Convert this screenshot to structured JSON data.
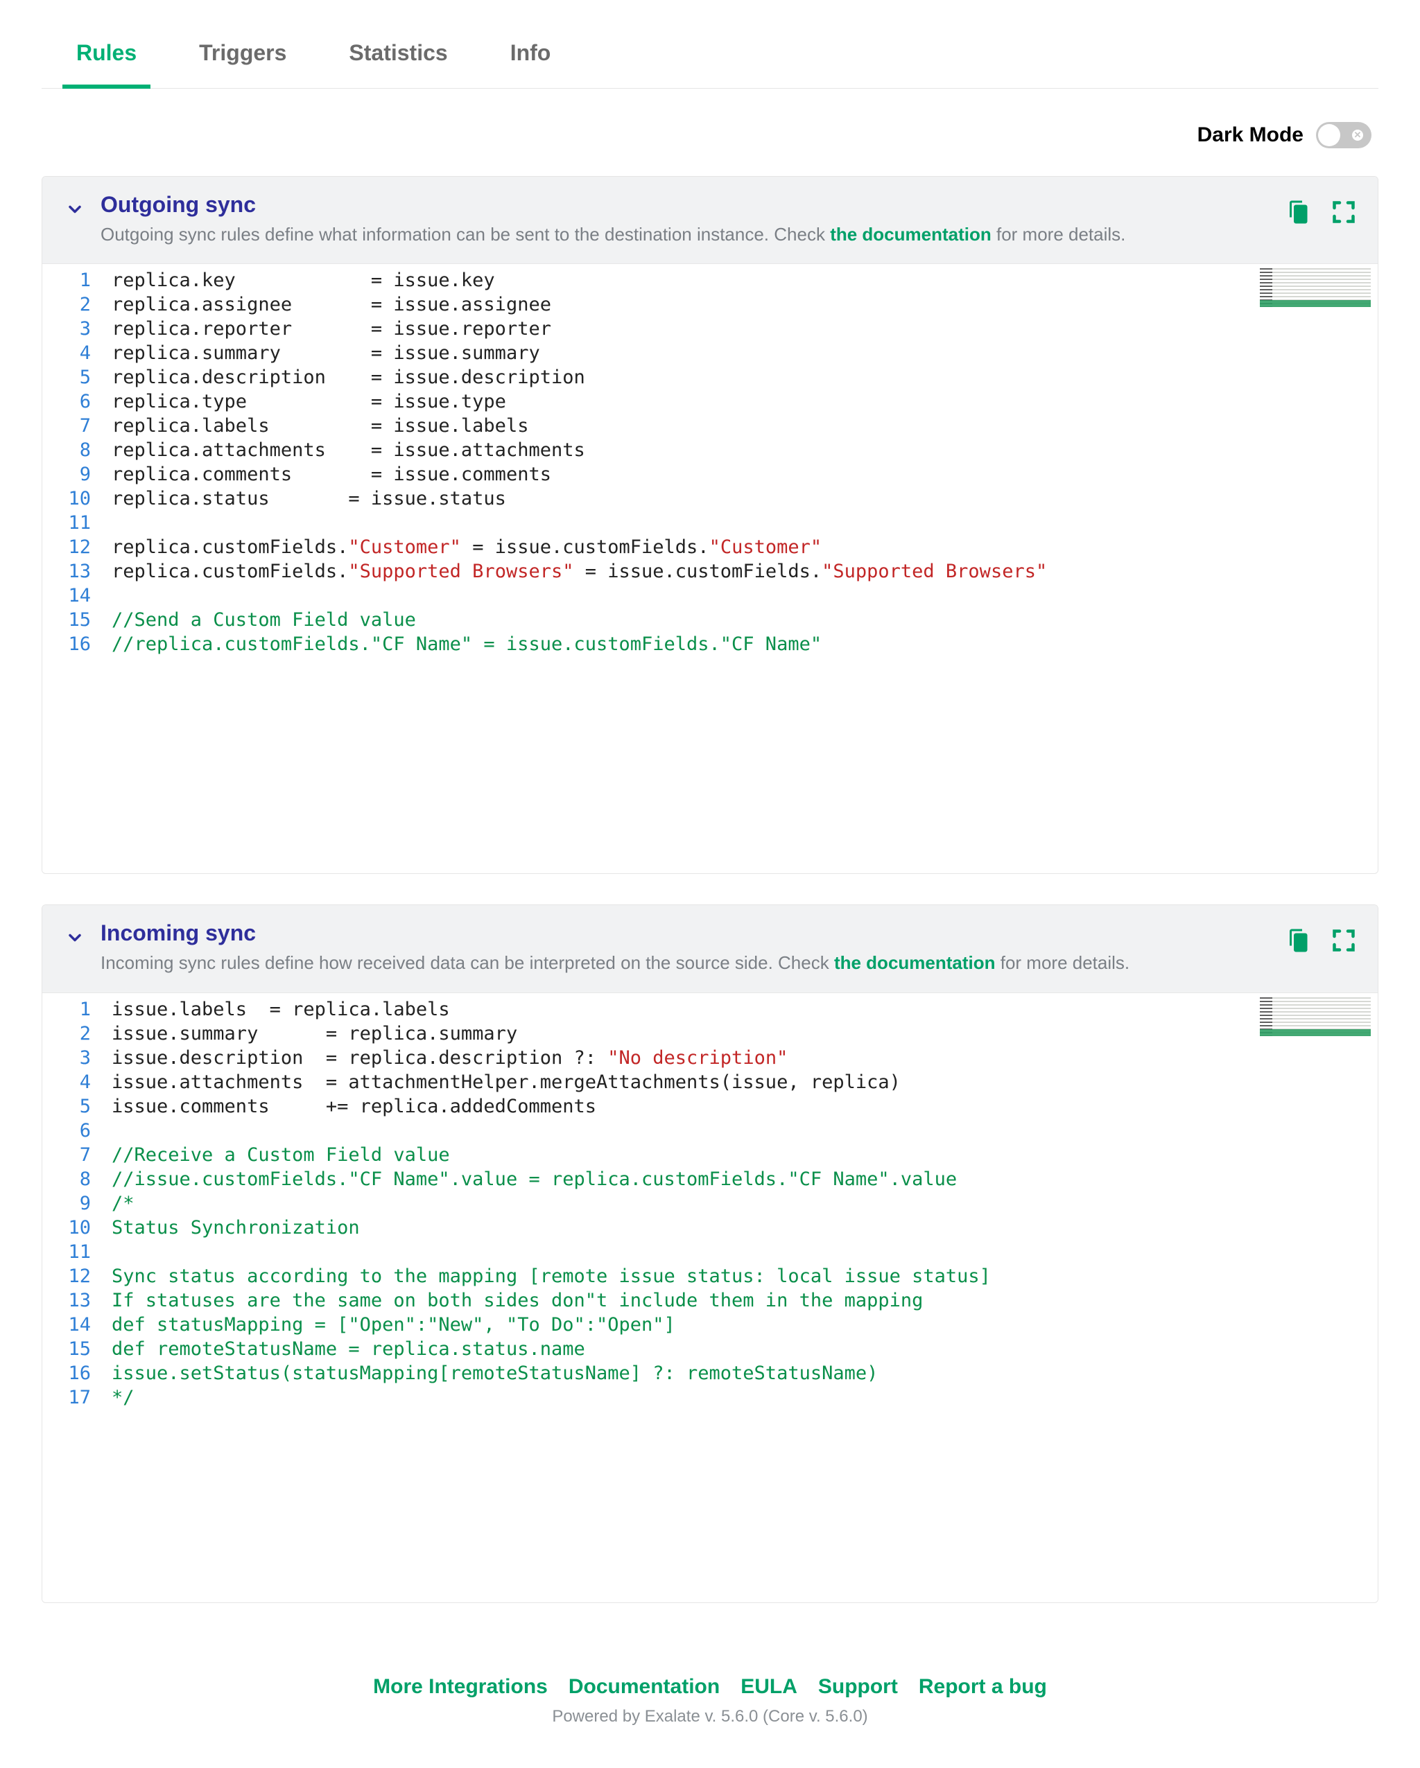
{
  "tabs": {
    "items": [
      "Rules",
      "Triggers",
      "Statistics",
      "Info"
    ],
    "active_index": 0
  },
  "dark_mode": {
    "label": "Dark Mode",
    "enabled": false
  },
  "panels": {
    "outgoing": {
      "title": "Outgoing sync",
      "subtitle_pre": "Outgoing sync rules define what information can be sent to the destination instance. Check ",
      "doc_link_text": "the documentation",
      "subtitle_post": " for more details.",
      "code": [
        [
          {
            "t": "plain",
            "v": "replica.key            = issue.key"
          }
        ],
        [
          {
            "t": "plain",
            "v": "replica.assignee       = issue.assignee"
          }
        ],
        [
          {
            "t": "plain",
            "v": "replica.reporter       = issue.reporter"
          }
        ],
        [
          {
            "t": "plain",
            "v": "replica.summary        = issue.summary"
          }
        ],
        [
          {
            "t": "plain",
            "v": "replica.description    = issue.description"
          }
        ],
        [
          {
            "t": "plain",
            "v": "replica.type           = issue.type"
          }
        ],
        [
          {
            "t": "plain",
            "v": "replica.labels         = issue.labels"
          }
        ],
        [
          {
            "t": "plain",
            "v": "replica.attachments    = issue.attachments"
          }
        ],
        [
          {
            "t": "plain",
            "v": "replica.comments       = issue.comments"
          }
        ],
        [
          {
            "t": "plain",
            "v": "replica.status       = issue.status"
          }
        ],
        [],
        [
          {
            "t": "plain",
            "v": "replica.customFields."
          },
          {
            "t": "str",
            "v": "\"Customer\""
          },
          {
            "t": "plain",
            "v": " = issue.customFields."
          },
          {
            "t": "str",
            "v": "\"Customer\""
          }
        ],
        [
          {
            "t": "plain",
            "v": "replica.customFields."
          },
          {
            "t": "str",
            "v": "\"Supported Browsers\""
          },
          {
            "t": "plain",
            "v": " = issue.customFields."
          },
          {
            "t": "str",
            "v": "\"Supported Browsers\""
          }
        ],
        [],
        [
          {
            "t": "cmt",
            "v": "//Send a Custom Field value"
          }
        ],
        [
          {
            "t": "cmt",
            "v": "//replica.customFields.\"CF Name\" = issue.customFields.\"CF Name\""
          }
        ]
      ]
    },
    "incoming": {
      "title": "Incoming sync",
      "subtitle_pre": "Incoming sync rules define how received data can be interpreted on the source side. Check ",
      "doc_link_text": "the documentation",
      "subtitle_post": " for more details.",
      "code": [
        [
          {
            "t": "plain",
            "v": "issue.labels  = replica.labels"
          }
        ],
        [
          {
            "t": "plain",
            "v": "issue.summary      = replica.summary"
          }
        ],
        [
          {
            "t": "plain",
            "v": "issue.description  = replica.description ?: "
          },
          {
            "t": "str",
            "v": "\"No description\""
          }
        ],
        [
          {
            "t": "plain",
            "v": "issue.attachments  = attachmentHelper.mergeAttachments(issue, replica)"
          }
        ],
        [
          {
            "t": "plain",
            "v": "issue.comments     += replica.addedComments"
          }
        ],
        [],
        [
          {
            "t": "cmt",
            "v": "//Receive a Custom Field value"
          }
        ],
        [
          {
            "t": "cmt",
            "v": "//issue.customFields.\"CF Name\".value = replica.customFields.\"CF Name\".value"
          }
        ],
        [
          {
            "t": "cmt",
            "v": "/*"
          }
        ],
        [
          {
            "t": "cmt",
            "v": "Status Synchronization"
          }
        ],
        [],
        [
          {
            "t": "cmt",
            "v": "Sync status according to the mapping [remote issue status: local issue status]"
          }
        ],
        [
          {
            "t": "cmt",
            "v": "If statuses are the same on both sides don\"t include them in the mapping"
          }
        ],
        [
          {
            "t": "cmt",
            "v": "def statusMapping = [\"Open\":\"New\", \"To Do\":\"Open\"]"
          }
        ],
        [
          {
            "t": "cmt",
            "v": "def remoteStatusName = replica.status.name"
          }
        ],
        [
          {
            "t": "cmt",
            "v": "issue.setStatus(statusMapping[remoteStatusName] ?: remoteStatusName)"
          }
        ],
        [
          {
            "t": "cmt",
            "v": "*/"
          }
        ]
      ]
    }
  },
  "footer": {
    "links": [
      "More Integrations",
      "Documentation",
      "EULA",
      "Support",
      "Report a bug"
    ],
    "powered": "Powered by Exalate v. 5.6.0 (Core v. 5.6.0)"
  },
  "icons": {
    "chevron": "chevron-down-icon",
    "copy": "copy-icon",
    "fullscreen": "fullscreen-icon"
  },
  "colors": {
    "accent": "#00b074",
    "link_green": "#00a068",
    "title_blue": "#2e2e9b",
    "gutter_blue": "#2f7fd6",
    "string_red": "#c22626",
    "comment_green": "#0a8f4a"
  }
}
